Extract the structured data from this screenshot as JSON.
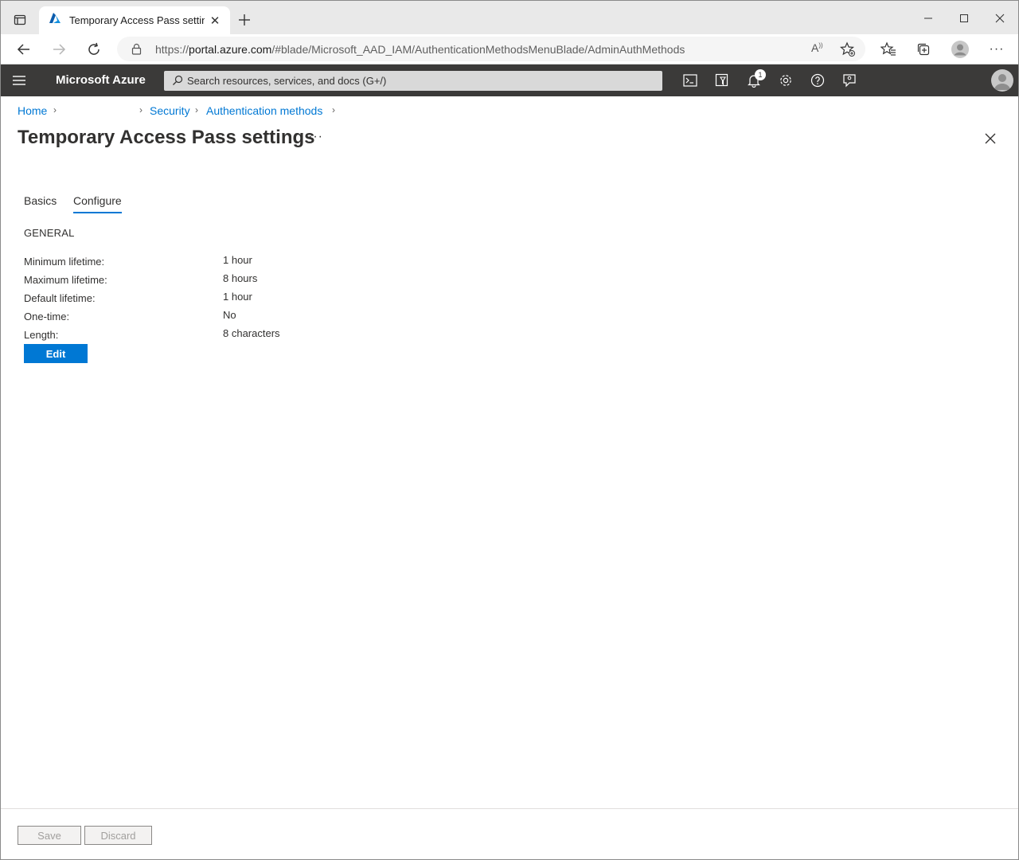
{
  "browser": {
    "tab_title": "Temporary Access Pass settings -",
    "url_prefix": "https://",
    "url_domain": "portal.azure.com",
    "url_path": "/#blade/Microsoft_AAD_IAM/AuthenticationMethodsMenuBlade/AdminAuthMethods"
  },
  "azure_bar": {
    "brand": "Microsoft Azure",
    "search_placeholder": "Search resources, services, and docs (G+/)",
    "notification_count": "1"
  },
  "breadcrumb": {
    "items": [
      "Home",
      "Security",
      "Authentication methods"
    ]
  },
  "page": {
    "title": "Temporary Access Pass settings",
    "more": "···"
  },
  "tabs": [
    {
      "label": "Basics",
      "active": false
    },
    {
      "label": "Configure",
      "active": true
    }
  ],
  "section": {
    "heading": "GENERAL",
    "fields": [
      {
        "label": "Minimum lifetime:",
        "value": "1 hour"
      },
      {
        "label": "Maximum lifetime:",
        "value": "8 hours"
      },
      {
        "label": "Default lifetime:",
        "value": "1 hour"
      },
      {
        "label": "One-time:",
        "value": "No"
      },
      {
        "label": "Length:",
        "value": "8 characters"
      }
    ],
    "edit_label": "Edit"
  },
  "footer": {
    "save_label": "Save",
    "discard_label": "Discard"
  },
  "colors": {
    "accent": "#0078d4",
    "topbar": "#3b3a39"
  }
}
